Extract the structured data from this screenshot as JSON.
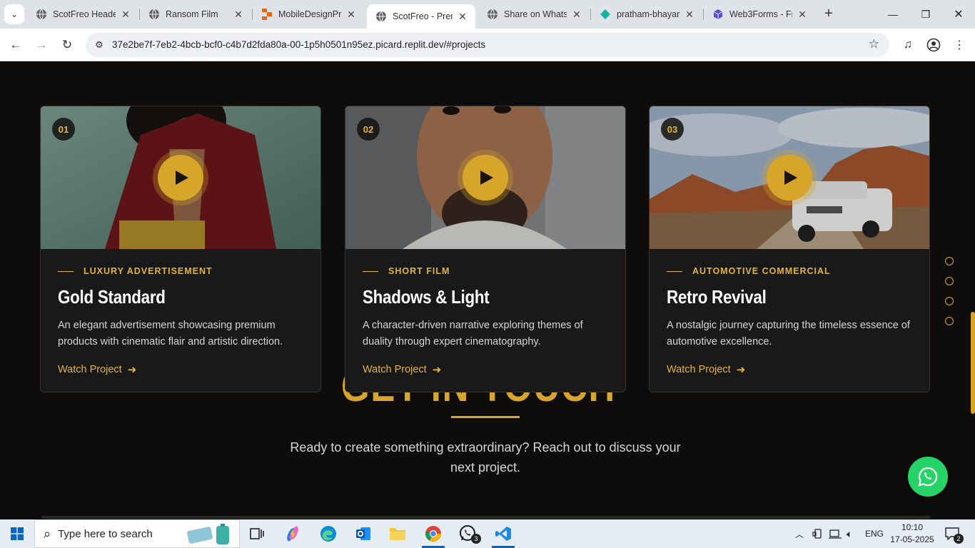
{
  "browser": {
    "tabs": [
      {
        "title": "ScotFreo Header",
        "active": false
      },
      {
        "title": "Ransom Film",
        "active": false
      },
      {
        "title": "MobileDesignPr",
        "active": false
      },
      {
        "title": "ScotFreo - Prem",
        "active": true
      },
      {
        "title": "Share on Whats",
        "active": false
      },
      {
        "title": "pratham-bhayar",
        "active": false
      },
      {
        "title": "Web3Forms - Fr",
        "active": false
      }
    ],
    "url": "37e2be7f-7eb2-4bcb-bcf0-c4b7d2fda80a-00-1p5h0501n95ez.picard.replit.dev/#projects"
  },
  "projects": [
    {
      "number": "01",
      "category": "LUXURY ADVERTISEMENT",
      "title": "Gold Standard",
      "description": "An elegant advertisement showcasing premium products with cinematic flair and artistic direction.",
      "link_label": "Watch Project"
    },
    {
      "number": "02",
      "category": "SHORT FILM",
      "title": "Shadows & Light",
      "description": "A character-driven narrative exploring themes of duality through expert cinematography.",
      "link_label": "Watch Project"
    },
    {
      "number": "03",
      "category": "AUTOMOTIVE COMMERCIAL",
      "title": "Retro Revival",
      "description": "A nostalgic journey capturing the timeless essence of automotive excellence.",
      "link_label": "Watch Project"
    }
  ],
  "contact": {
    "heading": "GET IN TOUCH",
    "subtitle": "Ready to create something extraordinary? Reach out to discuss your next project."
  },
  "taskbar": {
    "search_placeholder": "Type here to search",
    "whatsapp_badge": "3",
    "language": "ENG",
    "time": "10:10",
    "date": "17-05-2025",
    "notification_count": "2"
  },
  "colors": {
    "accent": "#d6a52a",
    "page_bg": "#0e0d0c",
    "card_bg": "#1a1919",
    "whatsapp": "#25d366"
  }
}
